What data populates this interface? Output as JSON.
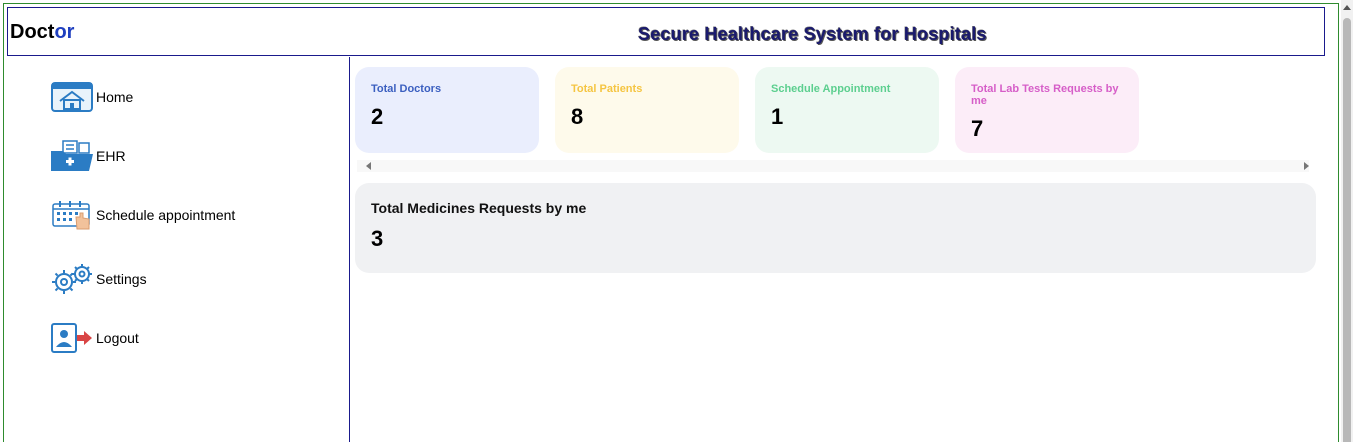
{
  "header": {
    "logo_part1": "Doct",
    "logo_part2": "or",
    "title": "Secure Healthcare System for Hospitals"
  },
  "sidebar": {
    "items": [
      {
        "label": "Home",
        "icon": "home-icon"
      },
      {
        "label": "EHR",
        "icon": "ehr-folder-icon"
      },
      {
        "label": "Schedule appointment",
        "icon": "calendar-icon"
      },
      {
        "label": "Settings",
        "icon": "gear-icon"
      },
      {
        "label": "Logout",
        "icon": "logout-icon"
      }
    ]
  },
  "cards": [
    {
      "label": "Total Doctors",
      "value": "2",
      "label_color": "#3b5fc0",
      "bg": "#eaeefd"
    },
    {
      "label": "Total Patients",
      "value": "8",
      "label_color": "#f5c542",
      "bg": "#fefaeb"
    },
    {
      "label": "Schedule Appointment",
      "value": "1",
      "label_color": "#5ccf8f",
      "bg": "#edf9f2"
    },
    {
      "label": "Total Lab Tests Requests by me",
      "value": "7",
      "label_color": "#d65ec8",
      "bg": "#fcedf8"
    }
  ],
  "medicines": {
    "label": "Total Medicines Requests by me",
    "value": "3"
  },
  "colors": {
    "frame_border": "#2e8b2e",
    "header_border": "#1a1a8c",
    "title_color": "#1a1a6e",
    "accent_blue": "#1f3fbf"
  }
}
